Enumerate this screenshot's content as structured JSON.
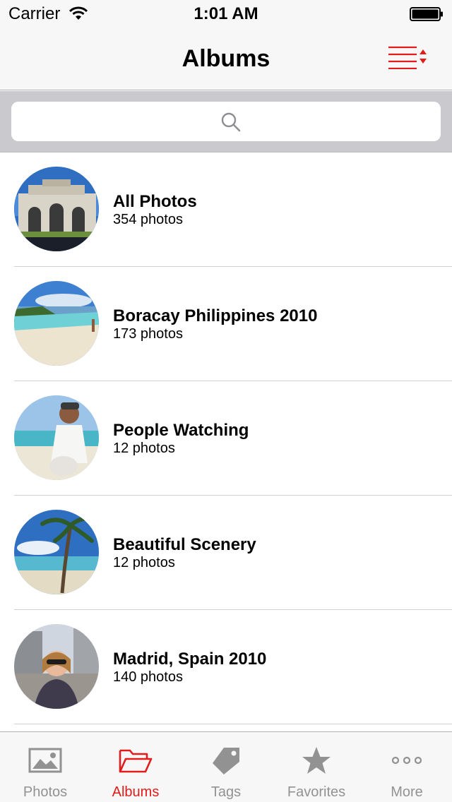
{
  "status_bar": {
    "carrier": "Carrier",
    "time": "1:01 AM"
  },
  "nav": {
    "title": "Albums",
    "sort_icon": "sort-list-icon"
  },
  "search": {
    "placeholder": "",
    "icon": "search-icon"
  },
  "albums": [
    {
      "name": "All Photos",
      "count": "354 photos"
    },
    {
      "name": "Boracay Philippines 2010",
      "count": "173 photos"
    },
    {
      "name": "People Watching",
      "count": "12 photos"
    },
    {
      "name": "Beautiful Scenery",
      "count": "12 photos"
    },
    {
      "name": "Madrid, Spain 2010",
      "count": "140 photos"
    }
  ],
  "tabs": [
    {
      "label": "Photos",
      "icon": "photos-icon",
      "active": false
    },
    {
      "label": "Albums",
      "icon": "folder-icon",
      "active": true
    },
    {
      "label": "Tags",
      "icon": "tag-icon",
      "active": false
    },
    {
      "label": "Favorites",
      "icon": "star-icon",
      "active": false
    },
    {
      "label": "More",
      "icon": "more-icon",
      "active": false
    }
  ],
  "colors": {
    "accent": "#e21b1b",
    "inactive": "#929292",
    "bar_bg": "#f7f7f7",
    "search_bg": "#c9c9ce"
  }
}
